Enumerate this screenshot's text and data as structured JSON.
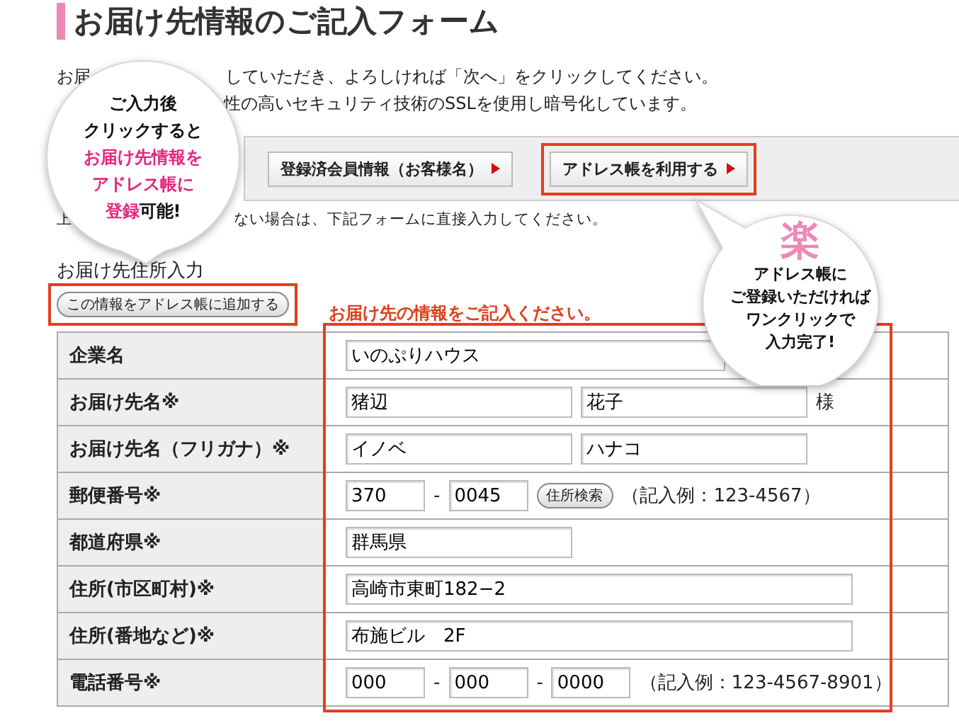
{
  "title": "お届け先情報のご記入フォーム",
  "intro": [
    {
      "parts": [
        "お届",
        "していただき、よろしければ「次へ」をクリックしてください。"
      ]
    },
    {
      "parts": [
        "性の高いセキュリティ技術のSSLを使用し暗号化しています。"
      ]
    }
  ],
  "member_buttons": [
    {
      "label": "登録済会員情報（お客様名）",
      "highlighted": false
    },
    {
      "label": "アドレス帳を利用する",
      "highlighted": true
    }
  ],
  "note": [
    "上",
    "ない場合は、下記フォームに直接入力してください。"
  ],
  "section_heading": "お届け先住所入力",
  "add_button": {
    "label": "この情報をアドレス帳に追加する",
    "highlighted": true
  },
  "form_caption": "お届け先の情報をご記入ください。",
  "rows": [
    {
      "label": "企業名",
      "kind": "company",
      "parts": [
        {
          "kind": "input",
          "value": "いのぷりハウス"
        }
      ]
    },
    {
      "label": "お届け先名※",
      "kind": "name",
      "parts": [
        {
          "kind": "input",
          "value": "猪辺"
        },
        {
          "kind": "input",
          "value": "花子"
        },
        {
          "kind": "text",
          "text": "様"
        }
      ]
    },
    {
      "label": "お届け先名（フリガナ）※",
      "kind": "name",
      "parts": [
        {
          "kind": "input",
          "value": "イノベ"
        },
        {
          "kind": "input",
          "value": "ハナコ"
        }
      ]
    },
    {
      "label": "郵便番号※",
      "kind": "code",
      "parts": [
        {
          "kind": "input",
          "value": "370"
        },
        {
          "kind": "text",
          "text": "-"
        },
        {
          "kind": "input",
          "value": "0045"
        },
        {
          "kind": "button",
          "label": "住所検索"
        },
        {
          "kind": "text",
          "text": "（記入例：123-4567）"
        }
      ]
    },
    {
      "label": "都道府県※",
      "kind": "name",
      "parts": [
        {
          "kind": "input",
          "value": "群馬県"
        }
      ]
    },
    {
      "label": "住所(市区町村)※",
      "kind": "address",
      "parts": [
        {
          "kind": "input",
          "value": "高崎市東町182−2"
        }
      ]
    },
    {
      "label": "住所(番地など)※",
      "kind": "address",
      "parts": [
        {
          "kind": "input",
          "value": "布施ビル　2F"
        }
      ]
    },
    {
      "label": "電話番号※",
      "kind": "code",
      "parts": [
        {
          "kind": "input",
          "value": "000"
        },
        {
          "kind": "text",
          "text": "-"
        },
        {
          "kind": "input",
          "value": "000"
        },
        {
          "kind": "text",
          "text": "-"
        },
        {
          "kind": "input",
          "value": "0000"
        },
        {
          "kind": "text",
          "text": "（記入例：123-4567-8901）"
        }
      ]
    }
  ],
  "callouts": [
    {
      "kind": "down",
      "lines": [
        [
          {
            "text": "ご入力後",
            "accent": false
          }
        ],
        [
          {
            "text": "クリックすると",
            "accent": false
          }
        ],
        [
          {
            "text": "お届け先情報を",
            "accent": true
          }
        ],
        [
          {
            "text": "アドレス帳に",
            "accent": true
          }
        ],
        [
          {
            "text": "登録",
            "accent": true
          },
          {
            "text": "可能!",
            "accent": false
          }
        ]
      ]
    },
    {
      "kind": "up",
      "badge": "楽",
      "lines": [
        [
          {
            "text": "アドレス帳に",
            "accent": false
          }
        ],
        [
          {
            "text": "ご登録いただければ",
            "accent": false
          }
        ],
        [
          {
            "text": "ワンクリックで",
            "accent": false
          }
        ],
        [
          {
            "text": "入力完了!",
            "accent": false
          }
        ]
      ]
    }
  ]
}
